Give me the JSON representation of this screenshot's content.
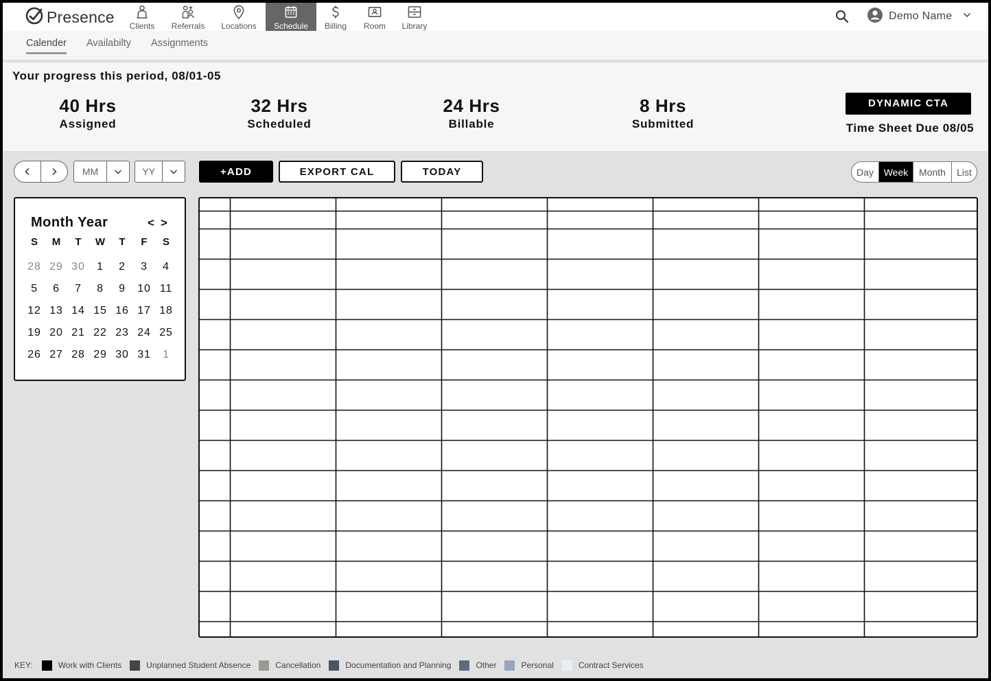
{
  "app": {
    "brand": "Presence"
  },
  "nav": {
    "items": [
      {
        "label": "Clients",
        "icon": "clients-icon"
      },
      {
        "label": "Referrals",
        "icon": "referrals-icon"
      },
      {
        "label": "Locations",
        "icon": "location-pin-icon"
      },
      {
        "label": "Schedule",
        "icon": "calendar-icon",
        "active": true
      },
      {
        "label": "Billing",
        "icon": "dollar-icon"
      },
      {
        "label": "Room",
        "icon": "room-icon"
      },
      {
        "label": "Library",
        "icon": "library-icon"
      }
    ],
    "user_name": "Demo Name"
  },
  "subnav": {
    "tabs": [
      {
        "label": "Calender",
        "active": true
      },
      {
        "label": "Availabilty"
      },
      {
        "label": "Assignments"
      }
    ]
  },
  "progress": {
    "title": "Your progress this period, 08/01-05",
    "stats": [
      {
        "value": "40 Hrs",
        "label": "Assigned"
      },
      {
        "value": "32 Hrs",
        "label": "Scheduled"
      },
      {
        "value": "24 Hrs",
        "label": "Billable"
      },
      {
        "value": "8 Hrs",
        "label": "Submitted"
      }
    ],
    "cta_label": "DYNAMIC CTA",
    "due_text": "Time Sheet Due 08/05"
  },
  "toolbar": {
    "month_placeholder": "MM",
    "year_placeholder": "YY",
    "add_label": "+ADD",
    "export_label": "EXPORT CAL",
    "today_label": "TODAY",
    "views": [
      {
        "label": "Day"
      },
      {
        "label": "Week",
        "active": true
      },
      {
        "label": "Month"
      },
      {
        "label": "List"
      }
    ]
  },
  "mini_calendar": {
    "title": "Month Year",
    "prev_label": "<",
    "next_label": ">",
    "weekdays": [
      "S",
      "M",
      "T",
      "W",
      "T",
      "F",
      "S"
    ],
    "weeks": [
      [
        "28",
        "29",
        "30",
        "1",
        "2",
        "3",
        "4"
      ],
      [
        "5",
        "6",
        "7",
        "8",
        "9",
        "10",
        "11"
      ],
      [
        "12",
        "13",
        "14",
        "15",
        "16",
        "17",
        "18"
      ],
      [
        "19",
        "20",
        "21",
        "22",
        "23",
        "24",
        "25"
      ],
      [
        "26",
        "27",
        "28",
        "29",
        "30",
        "31",
        "1"
      ]
    ],
    "other_month_cells": [
      "0-0",
      "0-1",
      "0-2",
      "4-6"
    ]
  },
  "key": {
    "title": "KEY:",
    "items": [
      {
        "label": "Work with Clients",
        "color": "#000000"
      },
      {
        "label": "Unplanned Student Absence",
        "color": "#444444"
      },
      {
        "label": "Cancellation",
        "color": "#999994"
      },
      {
        "label": "Documentation and Planning",
        "color": "#4a5560"
      },
      {
        "label": "Other",
        "color": "#5c6c80"
      },
      {
        "label": "Personal",
        "color": "#95a7bd"
      },
      {
        "label": "Contract Services",
        "color": "#eaeff5"
      }
    ]
  }
}
